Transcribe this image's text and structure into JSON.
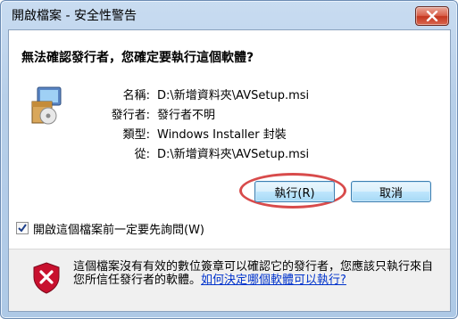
{
  "window": {
    "title": "開啟檔案 - 安全性警告"
  },
  "dialog": {
    "heading": "無法確認發行者，您確定要執行這個軟體?",
    "info": [
      {
        "label": "名稱:",
        "value": "D:\\新增資料夾\\AVSetup.msi"
      },
      {
        "label": "發行者:",
        "value": "發行者不明"
      },
      {
        "label": "類型:",
        "value": "Windows Installer 封裝"
      },
      {
        "label": "從:",
        "value": "D:\\新增資料夾\\AVSetup.msi"
      }
    ],
    "run_label": "執行(R)",
    "cancel_label": "取消",
    "checkbox": {
      "label": "開啟這個檔案前一定要先詢問(W)",
      "checked": true
    }
  },
  "footer": {
    "warning_text": "這個檔案沒有有效的數位簽章可以確認它的發行者，您應該只執行來自您所信任發行者的軟體。",
    "help_link": "如何決定哪個軟體可以執行?"
  },
  "colors": {
    "close_button": "#c4361f",
    "highlight_ring": "#d84b4b",
    "link": "#0033cc",
    "shield_red": "#c8102e"
  },
  "icons": [
    "close-icon",
    "installer-package-icon",
    "checkmark-icon",
    "shield-warning-icon"
  ]
}
